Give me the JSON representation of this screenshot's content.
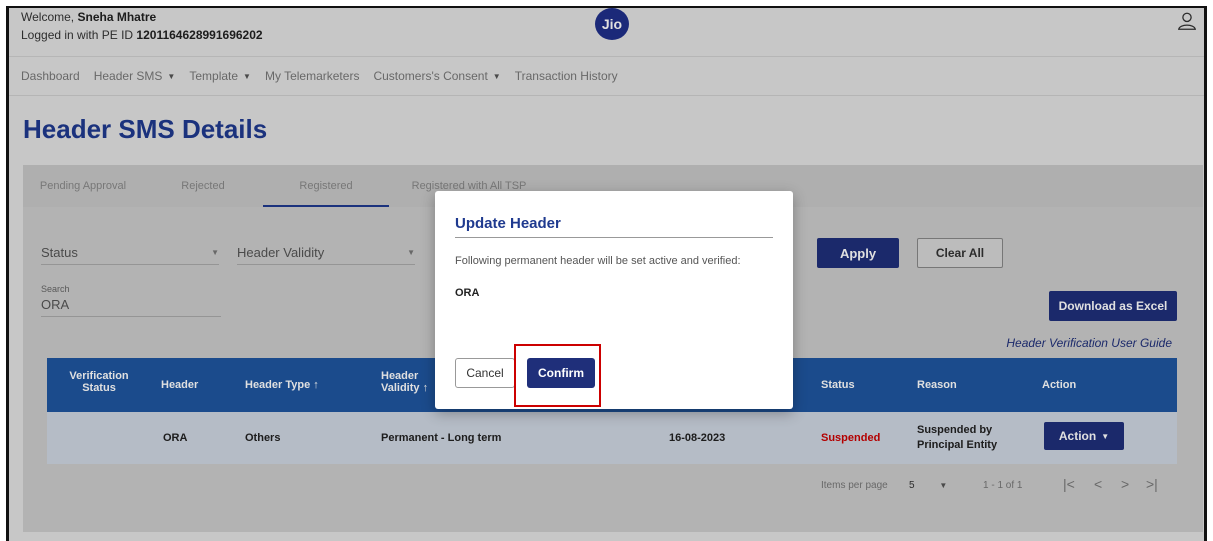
{
  "header": {
    "welcome_prefix": "Welcome,",
    "user_name": "Sneha Mhatre",
    "pe_prefix": "Logged in with PE ID",
    "pe_id": "1201164628991696202",
    "logo_text": "Jio"
  },
  "nav": {
    "items": [
      {
        "label": "Dashboard",
        "dropdown": false
      },
      {
        "label": "Header SMS",
        "dropdown": true
      },
      {
        "label": "Template",
        "dropdown": true
      },
      {
        "label": "My Telemarketers",
        "dropdown": false
      },
      {
        "label": "Customers's Consent",
        "dropdown": true
      },
      {
        "label": "Transaction History",
        "dropdown": false
      }
    ]
  },
  "page_title": "Header SMS Details",
  "tabs": [
    "Pending Approval",
    "Rejected",
    "Registered",
    "Registered with All TSP"
  ],
  "active_tab": "Registered",
  "filters": {
    "status_label": "Status",
    "validity_label": "Header Validity",
    "search_label": "Search",
    "search_value": "ORA",
    "apply": "Apply",
    "clear_all": "Clear All",
    "download": "Download as Excel",
    "guide_link": "Header Verification User Guide"
  },
  "table": {
    "headers": {
      "verification_status_1": "Verification",
      "verification_status_2": "Status",
      "header": "Header",
      "header_type": "Header Type",
      "header_validity_1": "Header",
      "header_validity_2": "Validity",
      "status": "Status",
      "reason": "Reason",
      "action": "Action"
    },
    "rows": [
      {
        "header": "ORA",
        "header_type": "Others",
        "validity": "Permanent - Long term",
        "date": "16-08-2023",
        "status": "Suspended",
        "reason_1": "Suspended by",
        "reason_2": "Principal Entity",
        "action": "Action"
      }
    ]
  },
  "pagination": {
    "items_per_page_label": "Items per page",
    "items_per_page": "5",
    "range": "1 - 1 of 1"
  },
  "dialog": {
    "title": "Update Header",
    "message": "Following permanent header will be set active and verified:",
    "header_value": "ORA",
    "cancel": "Cancel",
    "confirm": "Confirm"
  },
  "colors": {
    "brand_blue": "#1f2f7a",
    "table_header": "#1f56a0",
    "status_red": "#cc0000"
  }
}
